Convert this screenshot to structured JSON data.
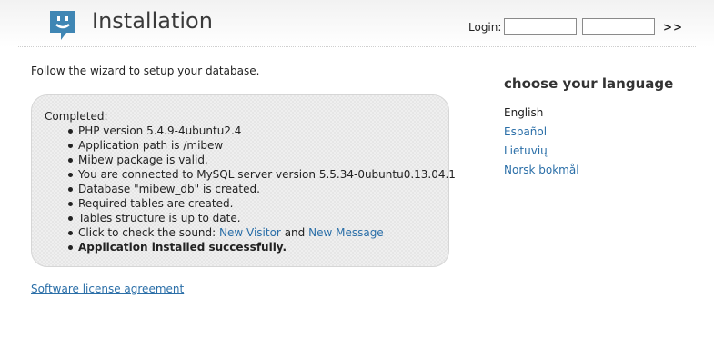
{
  "header": {
    "title": "Installation",
    "login_label": "Login:",
    "login_submit": ">>",
    "logo_icon": "chat-bubble-smile-icon"
  },
  "main": {
    "intro": "Follow the wizard to setup your database.",
    "status": {
      "title": "Completed:",
      "items": [
        "PHP version 5.4.9-4ubuntu2.4",
        "Application path is /mibew",
        "Mibew package is valid.",
        "You are connected to MySQL server version 5.5.34-0ubuntu0.13.04.1",
        "Database \"mibew_db\" is created.",
        "Required tables are created.",
        "Tables structure is up to date."
      ],
      "sound_prefix": "Click to check the sound:",
      "sound_link_visitor": "New Visitor",
      "sound_and": "and",
      "sound_link_message": "New Message",
      "success": "Application installed successfully."
    },
    "license_link": "Software license agreement"
  },
  "sidebar": {
    "title": "choose your language",
    "languages": [
      {
        "label": "English",
        "current": true
      },
      {
        "label": "Español",
        "current": false
      },
      {
        "label": "Lietuvių",
        "current": false
      },
      {
        "label": "Norsk bokmål",
        "current": false
      }
    ]
  },
  "colors": {
    "link": "#2b6fa8",
    "logo": "#3f86b4"
  }
}
